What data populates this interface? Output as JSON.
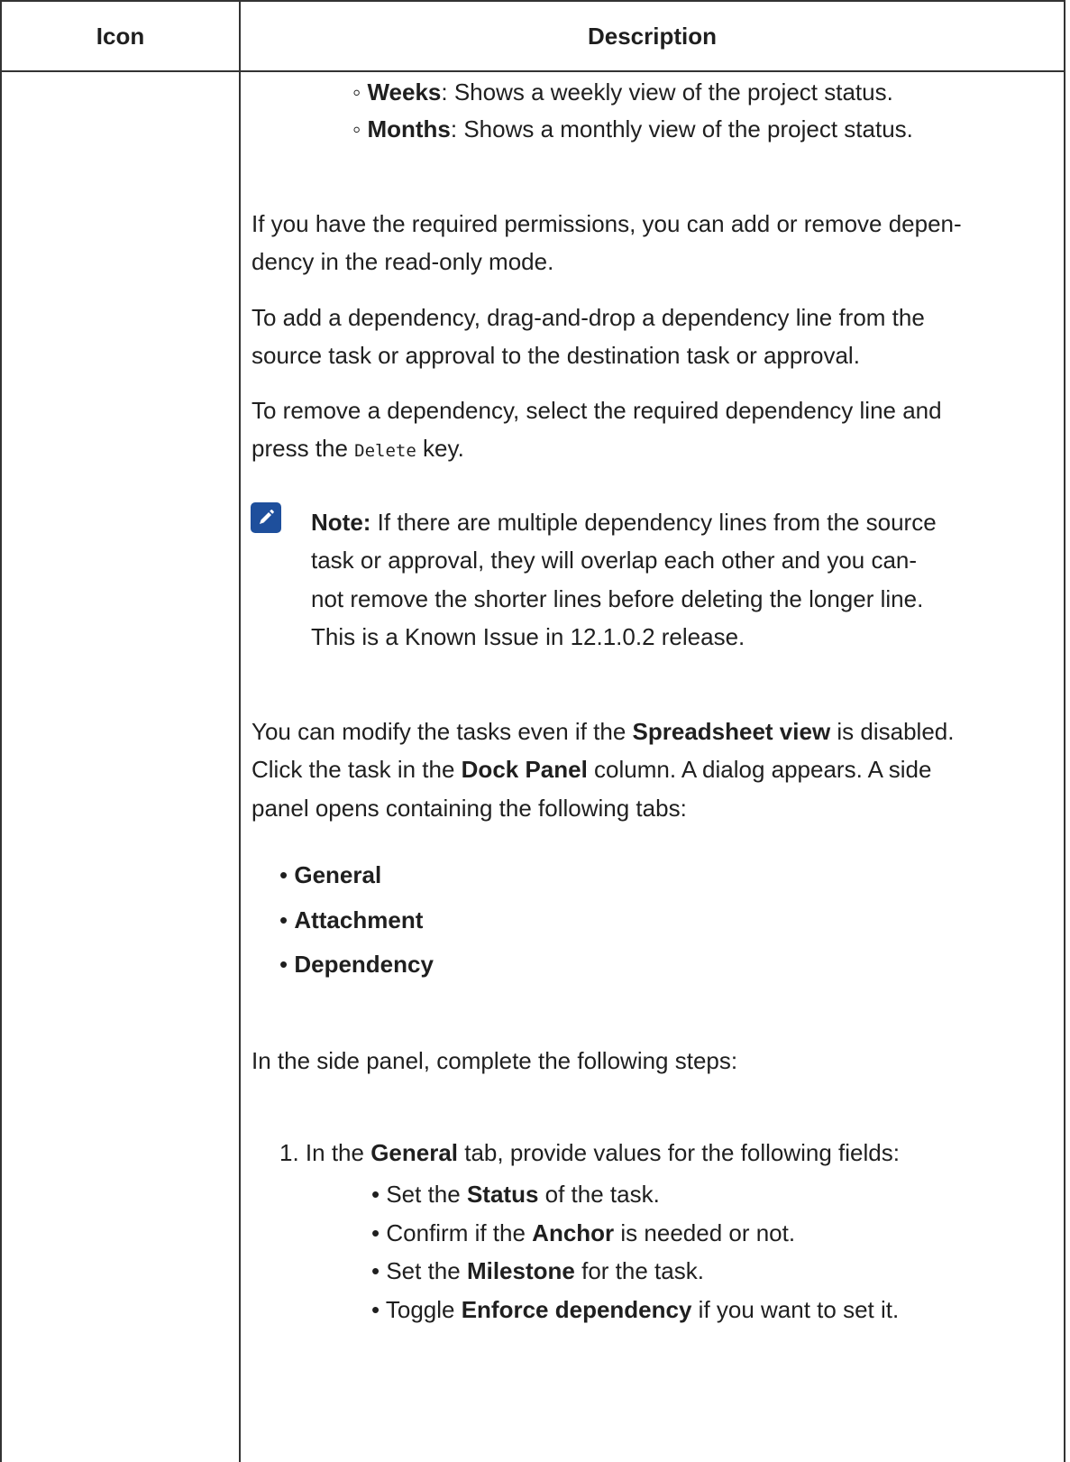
{
  "table": {
    "header_icon": "Icon",
    "header_description": "Description"
  },
  "sub_list": [
    {
      "bullet": "◦",
      "term": "Weeks",
      "text": ": Shows a weekly view of the project status."
    },
    {
      "bullet": "◦",
      "term": "Months",
      "text": ": Shows a monthly view of the project status."
    }
  ],
  "para_permissions": {
    "line1": "If you have the required permissions, you can add or remove depen-",
    "line2": "dency in the read-only mode."
  },
  "para_add": {
    "line1": "To add a dependency, drag-and-drop a dependency line from the",
    "line2": "source task or approval to the destination task or approval."
  },
  "para_remove": {
    "line1": "To remove a dependency, select the required dependency line and",
    "line2_pre": "press the ",
    "line2_code": "Delete",
    "line2_post": " key."
  },
  "note": {
    "icon": "pencil-note-icon",
    "label": "Note:",
    "line1": " If there are multiple dependency lines from the source",
    "line2": "task or approval, they will overlap each other and you can-",
    "line3": "not remove the shorter lines before deleting the longer line.",
    "line4": "This is a Known Issue in 12.1.0.2 release."
  },
  "para_modify": {
    "line1_pre": "You can modify the tasks even if the ",
    "line1_bold": "Spreadsheet view",
    "line1_post": " is disabled.",
    "line2_pre": "Click the task in the ",
    "line2_bold": "Dock Panel",
    "line2_post": " column. A dialog appears. A side",
    "line3": "panel opens containing the following tabs:"
  },
  "tabs_list": [
    {
      "bullet": "•",
      "label": "General"
    },
    {
      "bullet": "•",
      "label": "Attachment"
    },
    {
      "bullet": "•",
      "label": "Dependency"
    }
  ],
  "para_steps": "In the side panel, complete the following steps:",
  "step1": {
    "number": "1.",
    "pre": " In the ",
    "bold": "General",
    "post": " tab, provide values for the following fields:"
  },
  "fields": [
    {
      "bullet": "•",
      "pre": " Set the ",
      "bold": "Status",
      "post": " of the task."
    },
    {
      "bullet": "•",
      "pre": " Confirm if the ",
      "bold": "Anchor",
      "post": " is needed or not."
    },
    {
      "bullet": "•",
      "pre": " Set the ",
      "bold": "Milestone",
      "post": " for the task."
    },
    {
      "bullet": "•",
      "pre": " Toggle ",
      "bold": "Enforce dependency",
      "post": " if you want to set it."
    }
  ]
}
